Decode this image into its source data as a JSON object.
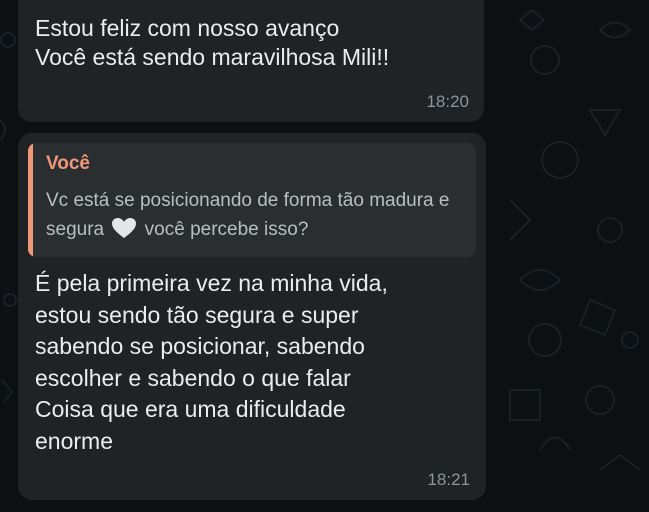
{
  "messages": [
    {
      "text": "Estou feliz com nosso avanço\nVocê está sendo maravilhosa Mili!!",
      "time": "18:20"
    },
    {
      "quote": {
        "author": "Você",
        "text_before": "Vc está se posicionando de forma tão madura e segura",
        "emoji": "white-heart-icon",
        "text_after": "você percebe isso?"
      },
      "text": "É pela primeira vez na minha vida,\nestou sendo tão segura e super\nsabendo se posicionar, sabendo\nescolher e sabendo o que falar\nCoisa que era uma dificuldade\nenorme",
      "time": "18:21"
    }
  ],
  "colors": {
    "background": "#0c1013",
    "bubble": "#1f2326",
    "quote_background": "#2a2e31",
    "quote_accent": "#f0977a",
    "text": "#e9edef",
    "time": "#8e9498"
  }
}
